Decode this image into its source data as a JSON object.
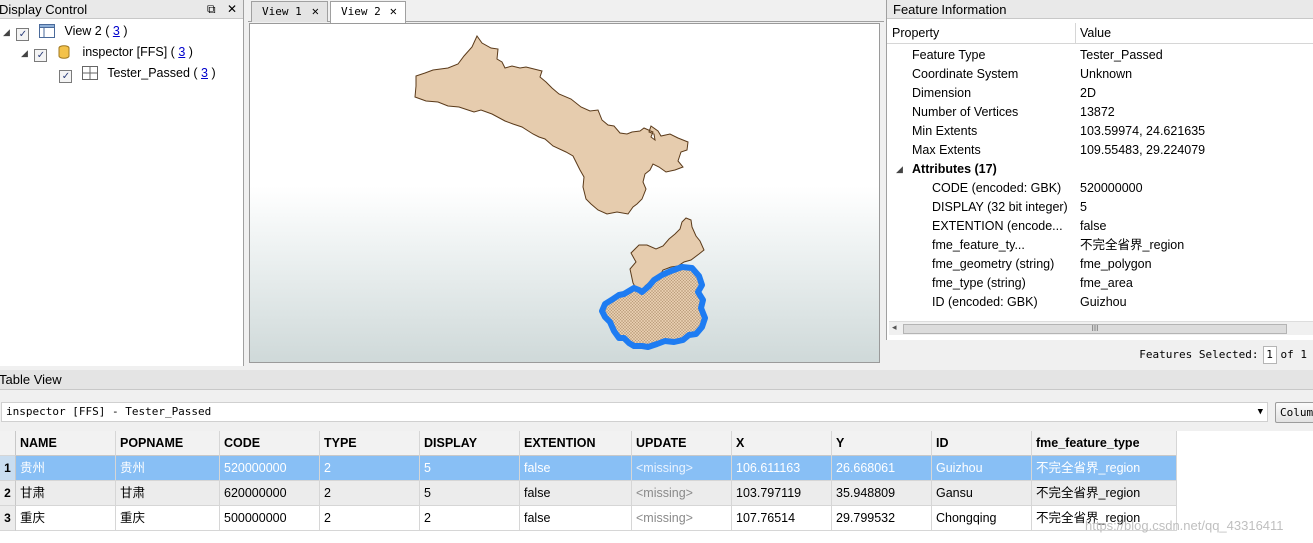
{
  "display_control": {
    "title": "Display Control",
    "tree": [
      {
        "label": "View 2 (",
        "count": "3",
        "close": ")"
      },
      {
        "label": "inspector [FFS] (",
        "count": "3",
        "close": ")"
      },
      {
        "label": "Tester_Passed (",
        "count": "3",
        "close": ")"
      }
    ]
  },
  "tabs": [
    {
      "label": "View 1"
    },
    {
      "label": "View 2"
    }
  ],
  "colors": {
    "selection": "#1e7cf2",
    "polygon_fill": "#e6ccae",
    "polygon_stroke": "#5a3a1a",
    "row_selected": "#88bff5"
  },
  "feature_info": {
    "title": "Feature Information",
    "header": {
      "property": "Property",
      "value": "Value"
    },
    "rows": [
      {
        "p": "Feature Type",
        "v": "Tester_Passed"
      },
      {
        "p": "Coordinate System",
        "v": "Unknown"
      },
      {
        "p": "Dimension",
        "v": "2D"
      },
      {
        "p": "Number of Vertices",
        "v": "13872"
      },
      {
        "p": "Min Extents",
        "v": "103.59974, 24.621635"
      },
      {
        "p": "Max Extents",
        "v": "109.55483, 29.224079"
      }
    ],
    "group": "Attributes (17)",
    "attributes": [
      {
        "p": "CODE (encoded: GBK)",
        "v": "520000000"
      },
      {
        "p": "DISPLAY (32 bit integer)",
        "v": "5"
      },
      {
        "p": "EXTENTION (encode...",
        "v": "false"
      },
      {
        "p": "fme_feature_ty...",
        "v": "不完全省界_region"
      },
      {
        "p": "fme_geometry (string)",
        "v": "fme_polygon"
      },
      {
        "p": "fme_type (string)",
        "v": "fme_area"
      },
      {
        "p": "ID (encoded: GBK)",
        "v": "Guizhou"
      }
    ],
    "scroll_thumb": "III"
  },
  "selection_status": {
    "label": "Features Selected:",
    "count": "1",
    "of": "of 1"
  },
  "table_view": {
    "title": "Table View",
    "source": "inspector [FFS] - Tester_Passed",
    "columns_button": "Columns",
    "headers": [
      "NAME",
      "POPNAME",
      "CODE",
      "TYPE",
      "DISPLAY",
      "EXTENTION",
      "UPDATE",
      "X",
      "Y",
      "ID",
      "fme_feature_type"
    ],
    "rows": [
      {
        "num": "1",
        "cells": [
          "贵州",
          "贵州",
          "520000000",
          "2",
          "5",
          "false",
          "<missing>",
          "106.611163",
          "26.668061",
          "Guizhou",
          "不完全省界_region"
        ]
      },
      {
        "num": "2",
        "cells": [
          "甘肃",
          "甘肃",
          "620000000",
          "2",
          "5",
          "false",
          "<missing>",
          "103.797119",
          "35.948809",
          "Gansu",
          "不完全省界_region"
        ]
      },
      {
        "num": "3",
        "cells": [
          "重庆",
          "重庆",
          "500000000",
          "2",
          "2",
          "false",
          "<missing>",
          "107.76514",
          "29.799532",
          "Chongqing",
          "不完全省界_region"
        ]
      }
    ]
  },
  "watermark": "https://blog.csdn.net/qq_43316411"
}
